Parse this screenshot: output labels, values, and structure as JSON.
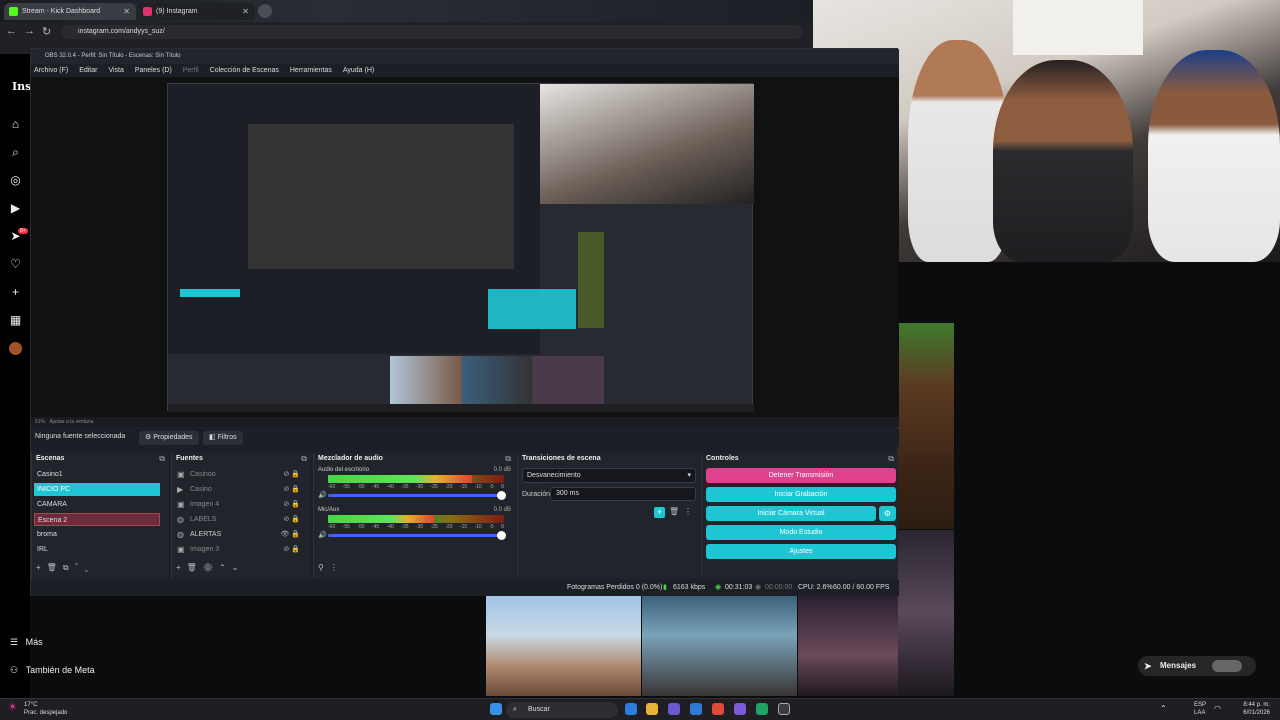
{
  "browser": {
    "tabs": [
      {
        "label": "Stream - Kick Dashboard",
        "color": "#53fc18"
      },
      {
        "label": "(9) Instagram",
        "color": "#e1306c"
      }
    ],
    "url": "instagram.com/andyys_suz/"
  },
  "instagram": {
    "logo": "Ins",
    "more_label": "Más",
    "meta_label": "También de Meta",
    "messages_label": "Mensajes",
    "rail_icons": [
      "home-icon",
      "search-icon",
      "explore-icon",
      "reels-icon",
      "send-icon",
      "heart-icon",
      "plus-icon",
      "dashboard-icon",
      "profile-icon"
    ],
    "notif_badge": "9+"
  },
  "obs": {
    "title": "OBS 32.0.4 - Perfil: Sin Título - Escenas: Sin Título",
    "menu": [
      "Archivo (F)",
      "Editar",
      "Vista",
      "Paneles (D)",
      "Perfil",
      "Colección de Escenas",
      "Herramientas",
      "Ayuda (H)"
    ],
    "zoom": "61%",
    "fit_label": "Ajustar a la ventana",
    "no_source": "Ninguna fuente seleccionada",
    "properties": "Propiedades",
    "filters": "Filtros",
    "scenes_title": "Escenas",
    "scenes": [
      "Casino1",
      "INICIO PC",
      "CAMARA",
      "Escena 2",
      "broma",
      "IRL"
    ],
    "sources_title": "Fuentes",
    "sources": [
      {
        "name": "Casinoo",
        "icon": "image-icon"
      },
      {
        "name": "Casino",
        "icon": "play-icon"
      },
      {
        "name": "Imagen 4",
        "icon": "image-icon"
      },
      {
        "name": "LABELS",
        "icon": "globe-icon"
      },
      {
        "name": "ALERTAS",
        "icon": "globe-icon"
      },
      {
        "name": "Imagen 3",
        "icon": "image-icon"
      }
    ],
    "mixer_title": "Mezclador de audio",
    "mixer": [
      {
        "name": "Audio del escritorio",
        "db": "0.0 dB",
        "level": 0.82
      },
      {
        "name": "Mic/Aux",
        "db": "0.0 dB",
        "level": 0.6
      }
    ],
    "scale": [
      "-60",
      "-55",
      "-50",
      "-45",
      "-40",
      "-35",
      "-30",
      "-25",
      "-20",
      "-15",
      "-10",
      "-5",
      "0"
    ],
    "transitions_title": "Transiciones de escena",
    "transition": "Desvanecimiento",
    "duration_label": "Duración",
    "duration": "300 ms",
    "controls_title": "Controles",
    "controls": [
      "Detener Transmisión",
      "Iniciar Grabación",
      "Iniciar Cámara Virtual",
      "Modo Estudio",
      "Ajustes"
    ],
    "status": {
      "dropped": "Fotogramas Perdidos 0 (0.0%)",
      "bitrate": "6163 kbps",
      "live": "00:31:03",
      "rec": "00:00:00",
      "cpu": "CPU: 2.6%",
      "fps": "60.00 / 60.00 FPS"
    }
  },
  "taskbar": {
    "temp": "17°C",
    "weather": "Prac. despejado",
    "search": "Buscar",
    "lang": "ESP",
    "lang2": "LAA",
    "time": "8:44 p. m.",
    "date": "6/01/2026"
  },
  "colors": {
    "accent": "#1ec6d4",
    "selected_scene": "#1ec6d4",
    "scene2": "#6b2d3a",
    "stop_stream": "#e0418e"
  }
}
